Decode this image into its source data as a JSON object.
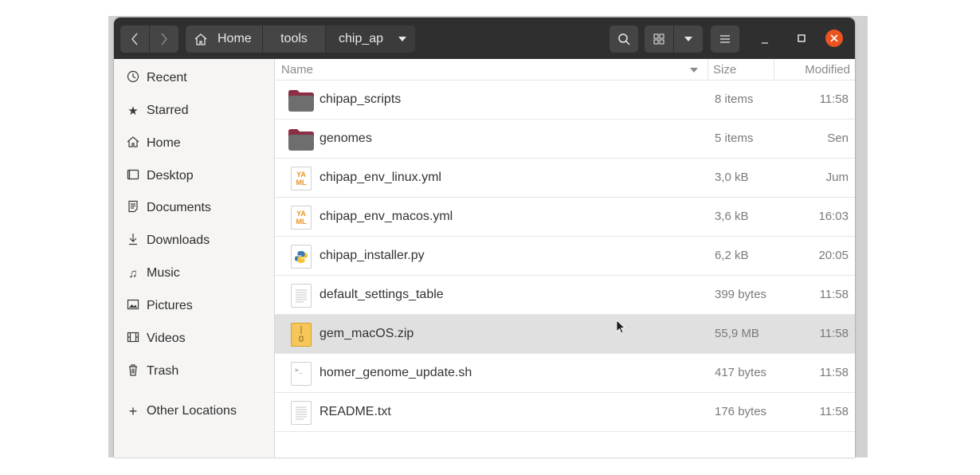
{
  "nav": {
    "back_icon": "chevron-left-icon",
    "forward_icon": "chevron-right-icon"
  },
  "path": [
    {
      "label": "Home",
      "icon": "home-icon"
    },
    {
      "label": "tools"
    },
    {
      "label": "chip_ap",
      "active": true
    }
  ],
  "toolbar": {
    "search_icon": "search-icon",
    "view_icon": "grid-view-icon",
    "menu_icon": "hamburger-icon"
  },
  "window_controls": {
    "minimize": "minimize-icon",
    "maximize": "maximize-icon",
    "close": "close-icon",
    "close_color": "#e95420"
  },
  "sidebar": {
    "items": [
      {
        "label": "Recent",
        "icon": "clock-icon"
      },
      {
        "label": "Starred",
        "icon": "star-icon"
      },
      {
        "label": "Home",
        "icon": "home-icon"
      },
      {
        "label": "Desktop",
        "icon": "desktop-icon"
      },
      {
        "label": "Documents",
        "icon": "document-icon"
      },
      {
        "label": "Downloads",
        "icon": "download-icon"
      },
      {
        "label": "Music",
        "icon": "music-icon"
      },
      {
        "label": "Pictures",
        "icon": "picture-icon"
      },
      {
        "label": "Videos",
        "icon": "video-icon"
      },
      {
        "label": "Trash",
        "icon": "trash-icon"
      },
      {
        "label": "Other Locations",
        "icon": "plus-icon"
      }
    ]
  },
  "columns": {
    "name": "Name",
    "size": "Size",
    "modified": "Modified"
  },
  "files": [
    {
      "name": "chipap_scripts",
      "size": "8 items",
      "modified": "11:58",
      "type": "folder"
    },
    {
      "name": "genomes",
      "size": "5 items",
      "modified": "Sen",
      "type": "folder"
    },
    {
      "name": "chipap_env_linux.yml",
      "size": "3,0 kB",
      "modified": "Jum",
      "type": "yaml"
    },
    {
      "name": "chipap_env_macos.yml",
      "size": "3,6 kB",
      "modified": "16:03",
      "type": "yaml"
    },
    {
      "name": "chipap_installer.py",
      "size": "6,2 kB",
      "modified": "20:05",
      "type": "python"
    },
    {
      "name": "default_settings_table",
      "size": "399 bytes",
      "modified": "11:58",
      "type": "text"
    },
    {
      "name": "gem_macOS.zip",
      "size": "55,9 MB",
      "modified": "11:58",
      "type": "zip",
      "selected": true
    },
    {
      "name": "homer_genome_update.sh",
      "size": "417 bytes",
      "modified": "11:58",
      "type": "script"
    },
    {
      "name": "README.txt",
      "size": "176 bytes",
      "modified": "11:58",
      "type": "text"
    }
  ],
  "yaml_icon_text": "YA ML",
  "script_icon_text": ">_"
}
